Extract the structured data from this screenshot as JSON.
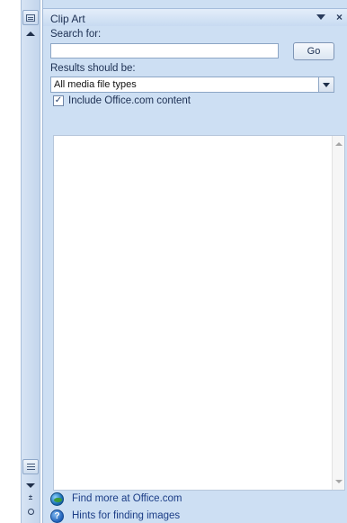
{
  "pane": {
    "title": "Clip Art",
    "close_glyph": "×"
  },
  "search": {
    "label": "Search for:",
    "value": "",
    "go_label": "Go"
  },
  "results": {
    "label": "Results should be:",
    "media_type_selected": "All media file types"
  },
  "office_content": {
    "checked": true,
    "check_glyph": "✓",
    "label": "Include Office.com content"
  },
  "links": {
    "find_more": "Find more at Office.com",
    "hints": "Hints for finding images",
    "hints_icon_glyph": "?"
  },
  "ruler": {
    "prev_page_glyph": "±"
  },
  "icons": {
    "pane_menu": "chevron-down-icon",
    "close": "close-icon",
    "find_more": "globe-icon",
    "hints": "help-icon"
  },
  "colors": {
    "pane_background": "#cddff3",
    "link_text": "#1b3d86"
  }
}
